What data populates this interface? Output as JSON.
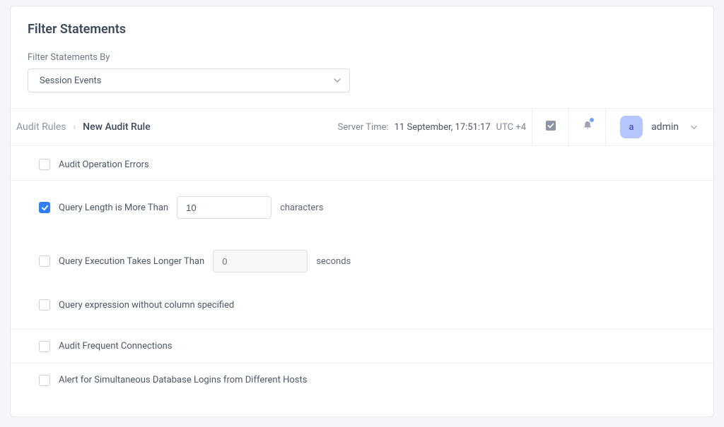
{
  "filter_section": {
    "title": "Filter Statements",
    "by_label": "Filter Statements By",
    "by_value": "Session Events"
  },
  "breadcrumb": {
    "parent": "Audit Rules",
    "current": "New Audit Rule"
  },
  "header": {
    "server_time_label": "Server Time:",
    "server_time_value": "11 September, 17:51:17",
    "server_time_tz": "UTC +4",
    "avatar_initial": "a",
    "user_name": "admin"
  },
  "options": {
    "audit_op_errors": {
      "label": "Audit Operation Errors",
      "checked": false
    },
    "query_length": {
      "label": "Query Length is More Than",
      "checked": true,
      "value": "10",
      "unit": "characters"
    },
    "query_exec": {
      "label": "Query Execution Takes Longer Than",
      "checked": false,
      "value": "0",
      "unit": "seconds"
    },
    "query_expr": {
      "label": "Query expression without column specified",
      "checked": false
    },
    "freq_conn": {
      "label": "Audit Frequent Connections",
      "checked": false
    },
    "simul_login": {
      "label": "Alert for Simultaneous Database Logins from Different Hosts",
      "checked": false
    }
  }
}
